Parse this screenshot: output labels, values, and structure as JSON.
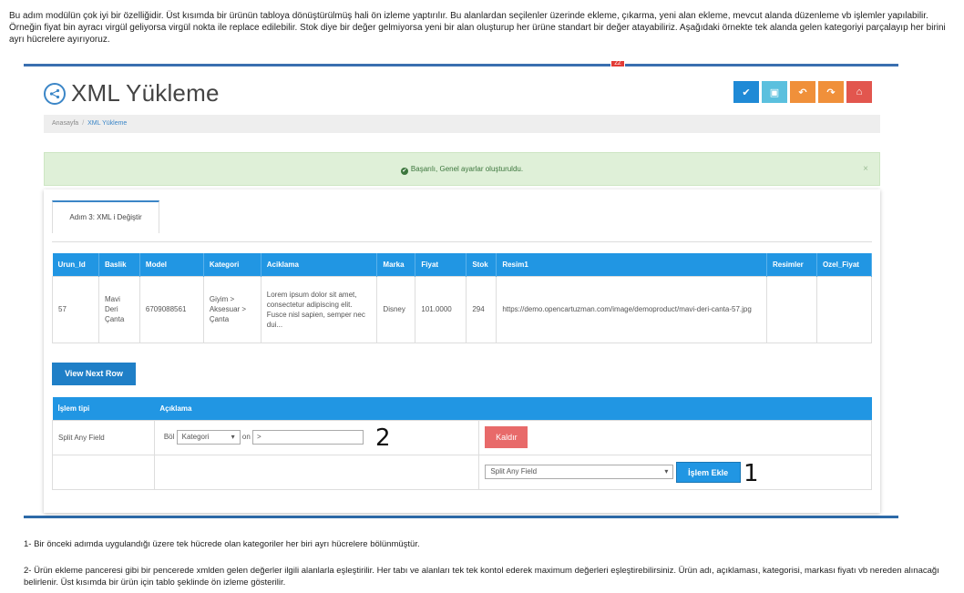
{
  "intro": "Bu adım modülün çok iyi bir özelliğidir. Üst kısımda bir ürünün tabloya dönüştürülmüş hali ön izleme yaptırılır. Bu alanlardan seçilenler üzerinde ekleme, çıkarma, yeni alan ekleme, mevcut alanda düzenleme vb işlemler yapılabilir. Örneğin fiyat bin ayracı virgül geliyorsa virgül nokta ile replace edilebilir. Stok diye bir değer gelmiyorsa yeni bir alan oluşturup her ürüne standart bir değer atayabiliriz. Aşağıdaki örnekte tek alanda gelen kategoriyi parçalayıp her birini ayrı hücrelere ayırıyoruz.",
  "marker_text": "ZZ",
  "page_title": "XML Yükleme",
  "toolbar": {
    "save": "✔",
    "disk": "▣",
    "undo": "↶",
    "redo": "↷",
    "home": "⌂"
  },
  "breadcrumb": {
    "home": "Anasayfa",
    "sep": "/",
    "current": "XML Yükleme"
  },
  "alert": {
    "text": "Başarılı, Genel ayarlar oluşturuldu.",
    "close": "×",
    "ok_icon": "✔"
  },
  "tab_label": "Adım 3: XML i Değiştir",
  "table": {
    "headers": [
      "Urun_Id",
      "Baslik",
      "Model",
      "Kategori",
      "Aciklama",
      "Marka",
      "Fiyat",
      "Stok",
      "Resim1",
      "Resimler",
      "Ozel_Fiyat"
    ],
    "row": [
      "57",
      "Mavi Deri Çanta",
      "6709088561",
      "Giyim > Aksesuar > Çanta",
      "Lorem ipsum dolor sit amet, consectetur adipiscing elit. Fusce nisl sapien, semper nec dui...",
      "Disney",
      "101.0000",
      "294",
      "https://demo.opencartuzman.com/image/demoproduct/mavi-deri-canta-57.jpg",
      "",
      ""
    ]
  },
  "next_row_label": "View Next Row",
  "ops": {
    "headers": [
      "İşlem tipi",
      "Açıklama",
      ""
    ],
    "row_type": "Split Any Field",
    "bol_label": "Böl",
    "field_select": "Kategori",
    "on_label": "on",
    "separator_value": ">",
    "remove_label": "Kaldır",
    "add_select": "Split Any Field",
    "add_label": "İşlem Ekle"
  },
  "callouts": {
    "one": "1",
    "two": "2"
  },
  "note1": "1- Bir önceki adımda uygulandığı üzere tek hücrede olan kategoriler her biri ayrı hücrelere bölünmüştür.",
  "note2": "2- Ürün ekleme panceresi gibi bir pencerede xmlden gelen değerler ilgili alanlarla eşleştirilir. Her tabı ve alanları tek tek kontol ederek maximum değerleri eşleştirebilirsiniz. Ürün adı, açıklaması, kategorisi, markası fiyatı vb nereden alınacağı belirlenir. Üst kısımda bir ürün için tablo şeklinde ön izleme gösterilir."
}
